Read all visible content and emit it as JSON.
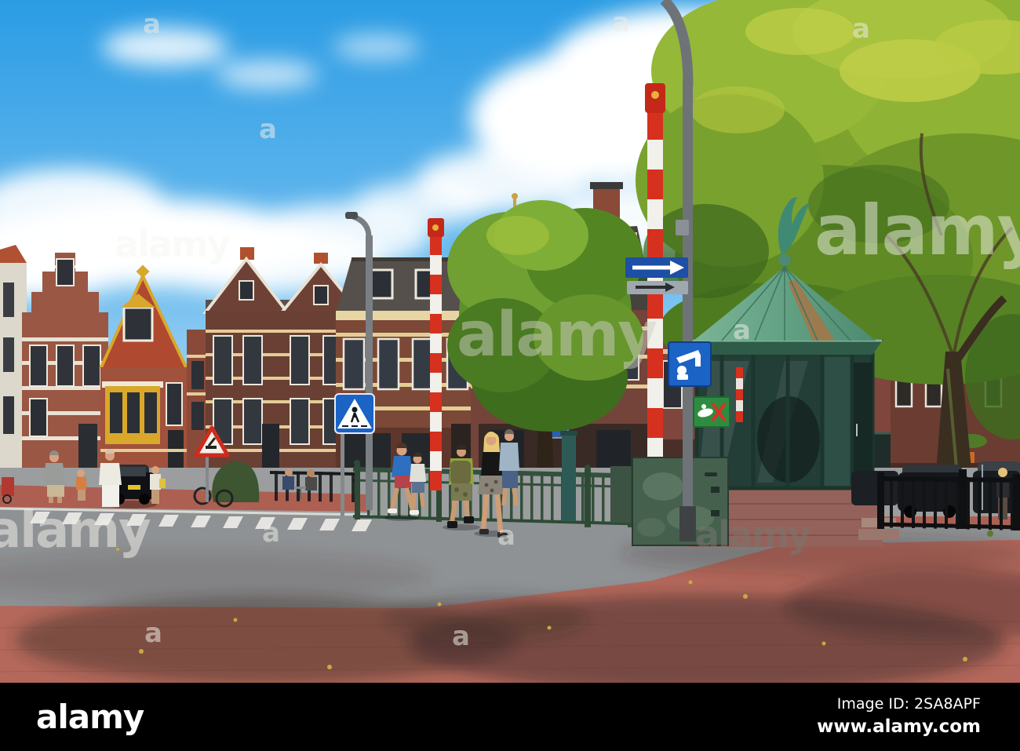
{
  "footer": {
    "logo_text": "alamy",
    "image_id": "Image ID: 2SA8APF",
    "website": "www.alamy.com"
  },
  "watermarks": {
    "brand": "alamy",
    "letter": "a"
  },
  "colors": {
    "sky_top": "#2b9ce4",
    "sky_horizon": "#c9e6f8",
    "cloud": "#ffffff",
    "tree_green": "#7fa62c",
    "tree_highlight": "#c2ce49",
    "brick_house": "#9a5743",
    "cream_band": "#e3ce96",
    "gold_trim": "#c9a242",
    "kiosk_roof_verdigris": "#6fae8e",
    "kiosk_glass": "#223e37",
    "kiosk_stone_base": "#94625a",
    "barrier_stripe_red": "#d6311f",
    "barrier_stripe_white": "#f2f0ea",
    "sign_blue": "#1b63c4",
    "sign_green": "#2e8c41",
    "fence_green": "#33503c",
    "fence_black": "#121416",
    "asphalt": "#8f9294",
    "brick_road": "#b3685b",
    "footer_bg": "#000000"
  }
}
